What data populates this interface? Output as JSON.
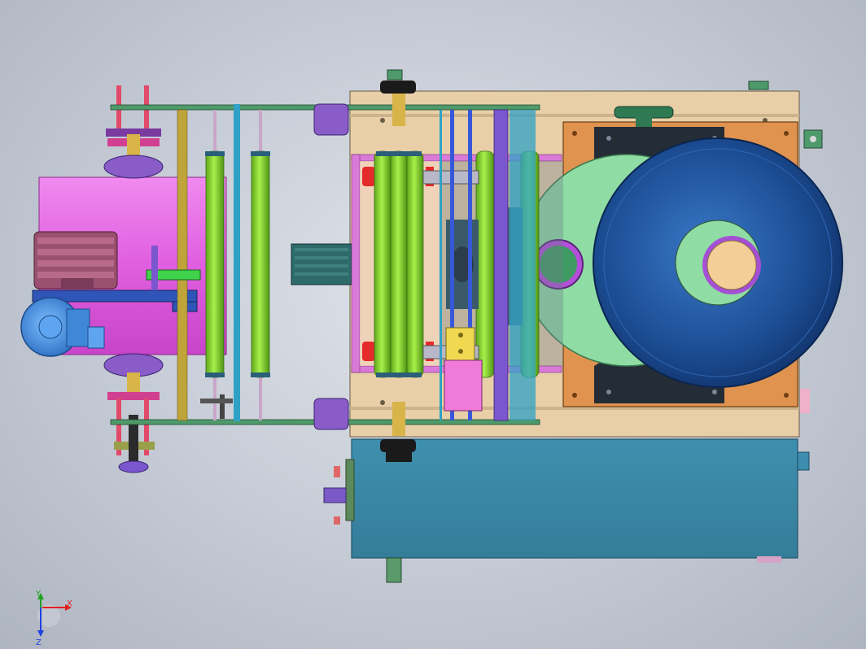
{
  "triad": {
    "x_label": "X",
    "y_label": "Y",
    "z_label": "Z"
  },
  "colors": {
    "frame_tan": "#e8cfa8",
    "base_steel_blue": "#3b87a4",
    "roller_green": "#8ede2e",
    "magenta_housing": "#e86ae8",
    "hopper_blue": "#1d4f96",
    "disk_mint": "#8fdca5",
    "mount_orange": "#e0924f",
    "bracket_black": "#242c36",
    "guide_rail_green": "#3f9a63",
    "motor_blue": "#3a8ee6",
    "violet_block": "#7a56cf",
    "purple_mount": "#8a5cc8",
    "gold_spindle": "#d9b449",
    "red_rod": "#e24a6a",
    "dark_slate": "#2b5f79",
    "cyan_rail": "#2fa1c6",
    "pink_block": "#f07ad8",
    "gray_gearbox": "#2e6a6a"
  },
  "icons": [
    "coordinate-triad-icon"
  ]
}
